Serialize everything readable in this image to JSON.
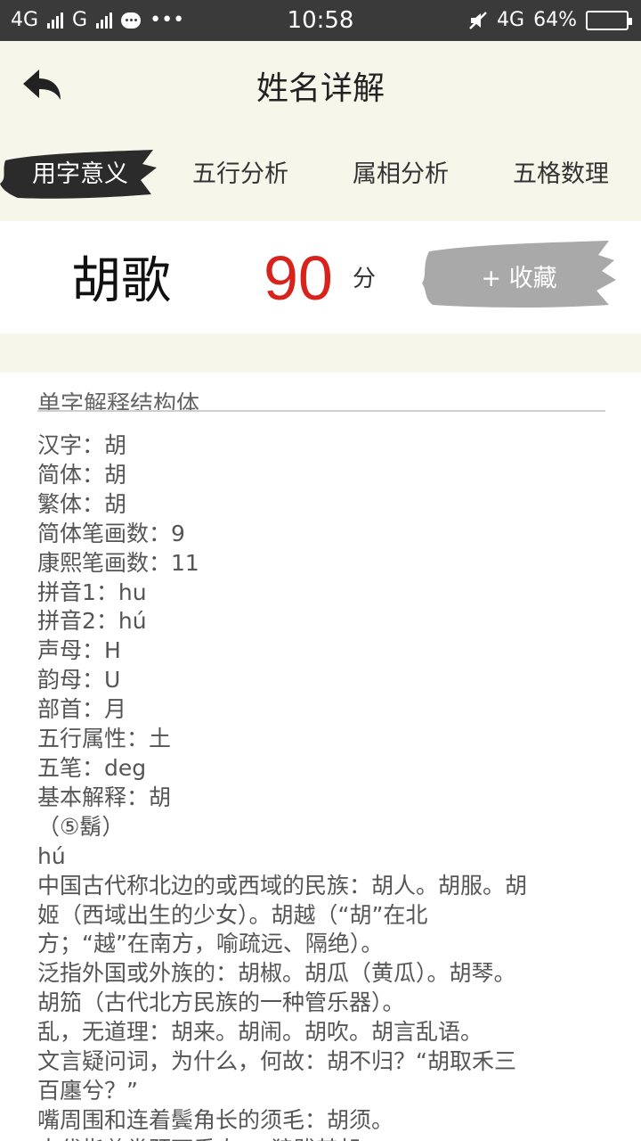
{
  "status_bar": {
    "net1": "4G",
    "net2": "G",
    "time": "10:58",
    "net3": "4G",
    "battery": "64%",
    "battery_level": 0.64
  },
  "header": {
    "title": "姓名详解",
    "back_icon": "back-arrow-icon"
  },
  "tabs": [
    {
      "label": "用字意义",
      "active": true
    },
    {
      "label": "五行分析",
      "active": false
    },
    {
      "label": "属相分析",
      "active": false
    },
    {
      "label": "五格数理",
      "active": false
    }
  ],
  "name_card": {
    "name": "胡歌",
    "score": "90",
    "score_unit": "分",
    "collect_label": "+ 收藏"
  },
  "colors": {
    "background": "#f7f6ea",
    "score": "#d8231c",
    "brush_active": "#2b2b2b",
    "brush_collect": "#a9a9a9"
  },
  "detail": {
    "section_title": "单字解释结构体",
    "lines": [
      "汉字：胡",
      "简体：胡",
      "繁体：胡",
      "简体笔画数：9",
      "康熙笔画数：11",
      "拼音1：hu",
      "拼音2：hú",
      "声母：H",
      "韵母：U",
      "部首：月",
      "五行属性：土",
      "五笔：deg",
      "基本解释：胡",
      "（⑤鬍）",
      "hú",
      "中国古代称北边的或西域的民族：胡人。胡服。胡",
      "姬（西域出生的少女）。胡越（“胡”在北",
      "方；“越”在南方，喻疏远、隔绝）。",
      "泛指外国或外族的：胡椒。胡瓜（黄瓜）。胡琴。",
      "胡笳（古代北方民族的一种管乐器）。",
      "乱，无道理：胡来。胡闹。胡吹。胡言乱语。",
      "文言疑问词，为什么，何故：胡不归？“胡取禾三",
      "百廛兮？”",
      "嘴周围和连着鬓角长的须毛：胡须。",
      "古代指兽类颈下垂肉：“狼跋其胡。”"
    ]
  }
}
